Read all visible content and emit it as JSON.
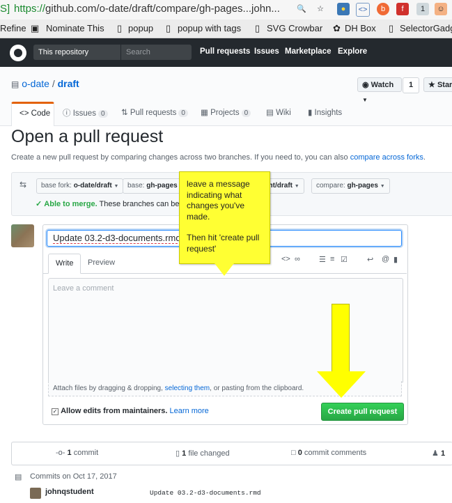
{
  "browser": {
    "left_glyph": "S]",
    "url_scheme": "https://",
    "url_rest": "github.com/o-date/draft/compare/gh-pages...john..."
  },
  "bookmarks": [
    "Refine",
    "Nominate This",
    "popup",
    "popup with tags",
    "SVG Crowbar",
    "DH Box",
    "SelectorGadg"
  ],
  "header": {
    "scope_label": "This repository",
    "search_placeholder": "Search",
    "nav": [
      "Pull requests",
      "Issues",
      "Marketplace",
      "Explore"
    ]
  },
  "repo": {
    "owner": "o-date",
    "separator": "/",
    "name": "draft",
    "watch_label": "Watch",
    "watch_count": "1",
    "star_label": "Star"
  },
  "tabs": [
    {
      "label": "Code"
    },
    {
      "label": "Issues",
      "count": "0"
    },
    {
      "label": "Pull requests",
      "count": "0"
    },
    {
      "label": "Projects",
      "count": "0"
    },
    {
      "label": "Wiki"
    },
    {
      "label": "Insights"
    }
  ],
  "page": {
    "title": "Open a pull request",
    "description": "Create a new pull request by comparing changes across two branches. If you need to, you can also ",
    "compare_link": "compare across forks",
    "description_end": "."
  },
  "range": {
    "base_fork_label": "base fork:",
    "base_fork_value": "o-date/draft",
    "base_label": "base:",
    "base_value": "gh-pages",
    "head_fork_partial": "ent/draft",
    "compare_label": "compare:",
    "compare_value": "gh-pages",
    "able_to_merge": "Able to merge.",
    "merge_text": "These branches can be a"
  },
  "form": {
    "title_value": "Update 03.2-d3-documents.rmd",
    "write_tab": "Write",
    "preview_tab": "Preview",
    "comment_placeholder": "Leave a comment",
    "attach_text_1": "Attach files by dragging & dropping, ",
    "attach_link": "selecting them",
    "attach_text_2": ", or pasting from the clipboard.",
    "allow_edits": "Allow edits from maintainers.",
    "learn_more": "Learn more",
    "create_button": "Create pull request"
  },
  "stats": {
    "commits_count": "1",
    "commits_label": "commit",
    "files_count": "1",
    "files_label": "file changed",
    "comments_count": "0",
    "comments_label": "commit comments",
    "contrib_count": "1"
  },
  "commits": {
    "heading": "Commits on Oct 17, 2017",
    "author": "johnqstudent",
    "message": "Update 03.2-d3-documents.rmd"
  },
  "annotation": {
    "line1": "leave a message indicating what changes you've made.",
    "line2": "Then hit 'create pull request'"
  }
}
